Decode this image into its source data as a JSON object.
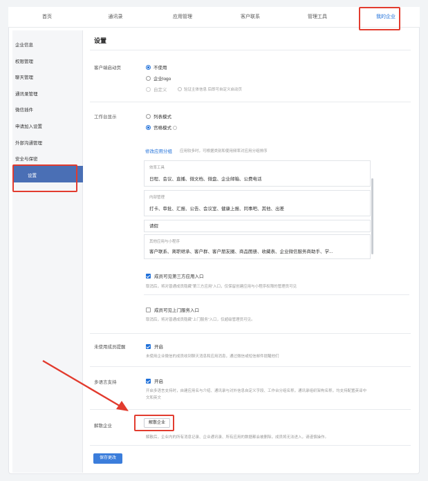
{
  "nav": {
    "items": [
      {
        "label": "首页"
      },
      {
        "label": "通讯录"
      },
      {
        "label": "应用管理"
      },
      {
        "label": "客户联系"
      },
      {
        "label": "管理工具"
      },
      {
        "label": "我的企业"
      }
    ],
    "active_index": 5
  },
  "sidebar": {
    "items": [
      {
        "label": "企业信息"
      },
      {
        "label": "权限管理"
      },
      {
        "label": "聊天管理"
      },
      {
        "label": "通讯录管理"
      },
      {
        "label": "微信插件"
      },
      {
        "label": "申请加入设置"
      },
      {
        "label": "外部沟通管理"
      },
      {
        "label": "安全与保密"
      },
      {
        "label": "设置"
      }
    ],
    "active_index": 8
  },
  "page": {
    "title": "设置"
  },
  "customer_start_page": {
    "label": "客户端启动页",
    "options": [
      {
        "label": "不使用",
        "selected": true
      },
      {
        "label": "企业logo",
        "selected": false
      },
      {
        "label": "自定义",
        "selected": false,
        "disabled": true
      }
    ],
    "custom_hint": "验证主体信息 后即可自定义启动页"
  },
  "workbench": {
    "label": "工作台显示",
    "options": [
      {
        "label": "列表模式",
        "selected": false
      },
      {
        "label": "宫格模式",
        "selected": true
      }
    ],
    "modify_link": "修改应用分组",
    "modify_hint": "应用较多时，可根据类别和使用频率对应用分组排序",
    "groups": [
      {
        "title": "效率工具",
        "apps": "日程、会议、直播、微文档、微盘、企业邮箱、公费电话"
      },
      {
        "title": "内部管理",
        "apps": "打卡、审批、汇报、公告、会议室、健康上报、同事吧、其他、出差"
      },
      {
        "title": "",
        "apps": "请假"
      },
      {
        "title": "其他应用与小程序",
        "apps": "客户联系、离职继承、客户群、客户朋友圈、商品图册、收藏表、企业微信服务商助手、学..."
      }
    ],
    "third_party": {
      "label": "成员可见第三方应用入口",
      "checked": true,
      "hint": "取消后，将对普通成员隐藏“第三方应用”入口，仅保留创建应用与小程序权限的管理员可见"
    },
    "door_service": {
      "label": "成员可见上门服务入口",
      "checked": false,
      "hint": "取消后，将对普通成员隐藏“上门服务”入口，仅超级管理员可见。"
    }
  },
  "unused_reminder": {
    "label": "未使用成员提醒",
    "checkbox_label": "开启",
    "checked": true,
    "hint": "未使用企业微信的成员收到聊天消息和应用消息，通过微信或短信邮件提醒他们"
  },
  "multi_language": {
    "label": "多语言支持",
    "checkbox_label": "开启",
    "checked": true,
    "hint_line1": "开启多语言支持时，自建应用名与介绍、通讯录与对外信息自定义字段、工作台分组名称，通讯录组织架构名称，均支持配置英译中",
    "hint_line2": "文和英文"
  },
  "dissolve": {
    "label": "解散企业",
    "button": "解散企业",
    "hint": "解散后，企业内的所有消息记录、企业通讯录、所有应用的数据都会被删除，成员将无法进入，请谨慎操作。"
  },
  "save_button": "保存更改",
  "colors": {
    "accent": "#1e6fd9",
    "sidebar_active": "#4a6fb5",
    "annotation_red": "#e23b2e"
  }
}
